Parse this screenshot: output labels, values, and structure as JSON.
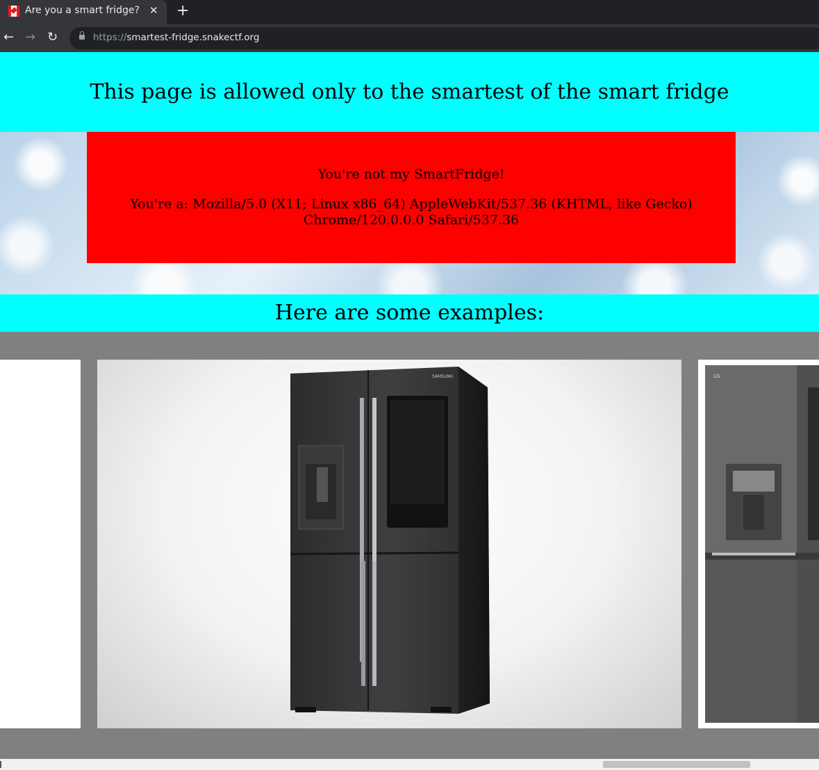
{
  "browser": {
    "tab_title": "Are you a smart fridge?",
    "tab_close": "✕",
    "new_tab": "+",
    "url_scheme": "https://",
    "url_host": "smartest-fridge.snakectf.org",
    "back_icon": "←",
    "forward_icon": "→",
    "reload_icon": "↻"
  },
  "page": {
    "heading": "This page is allowed only to the smartest of the smart fridge",
    "alert_line1": "You're not my SmartFridge!",
    "alert_line2": "You're a: Mozilla/5.0 (X11; Linux x86_64) AppleWebKit/537.36 (KHTML, like Gecko) Chrome/120.0.0.0 Safari/537.36",
    "examples_heading": "Here are some examples:"
  },
  "images": {
    "fridge_samsung_brand": "SAMSUNG",
    "fridge_lg_brand": "LG"
  },
  "colors": {
    "header_bg": "#00ffff",
    "alert_bg": "#ff0000",
    "gallery_bg": "#808080"
  }
}
